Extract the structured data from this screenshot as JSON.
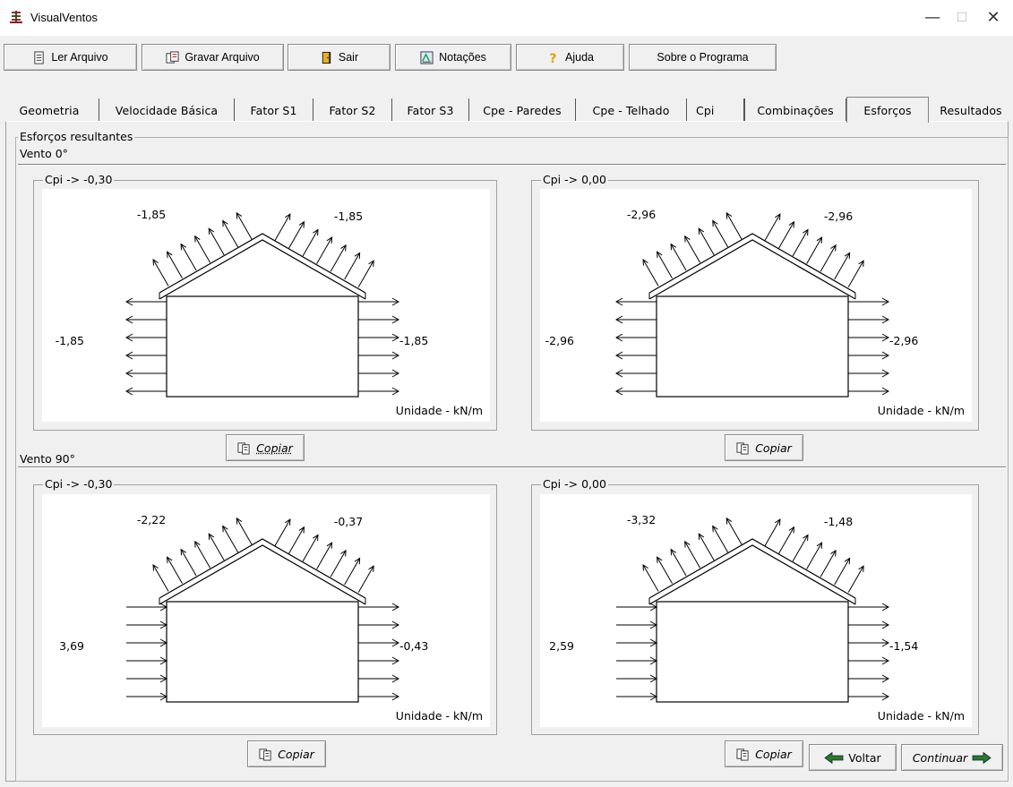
{
  "window": {
    "title": "VisualVentos",
    "minimize": "—",
    "maximize": "☐",
    "close": "✕"
  },
  "toolbar": {
    "open_label": "Ler Arquivo",
    "save_label": "Gravar Arquivo",
    "exit_label": "Sair",
    "notation_label": "Notações",
    "help_label": "Ajuda",
    "about_label": "Sobre o Programa"
  },
  "tabs": [
    {
      "label": "Geometria"
    },
    {
      "label": "Velocidade Básica"
    },
    {
      "label": "Fator S1"
    },
    {
      "label": "Fator S2"
    },
    {
      "label": "Fator S3"
    },
    {
      "label": "Cpe - Paredes"
    },
    {
      "label": "Cpe - Telhado"
    },
    {
      "label": "Cpi"
    },
    {
      "label": "Combinações"
    },
    {
      "label": "Esforços"
    },
    {
      "label": "Resultados"
    }
  ],
  "main": {
    "group_title": "Esforços resultantes",
    "unit": "Unidade - kN/m",
    "copy_label": "Copiar",
    "back_label": "Voltar",
    "next_label": "Continuar"
  },
  "sections": [
    {
      "title": "Vento 0°",
      "diagrams": [
        {
          "cpi_label": "Cpi -> -0,30",
          "roof_left": "-1,85",
          "roof_right": "-1,85",
          "wall_left": "-1,85",
          "wall_right": "-1,85",
          "left_wall_dir": "out",
          "right_wall_dir": "out"
        },
        {
          "cpi_label": "Cpi -> 0,00",
          "roof_left": "-2,96",
          "roof_right": "-2,96",
          "wall_left": "-2,96",
          "wall_right": "-2,96",
          "left_wall_dir": "out",
          "right_wall_dir": "out"
        }
      ]
    },
    {
      "title": "Vento 90°",
      "diagrams": [
        {
          "cpi_label": "Cpi -> -0,30",
          "roof_left": "-2,22",
          "roof_right": "-0,37",
          "wall_left": "3,69",
          "wall_right": "-0,43",
          "left_wall_dir": "in",
          "right_wall_dir": "out"
        },
        {
          "cpi_label": "Cpi -> 0,00",
          "roof_left": "-3,32",
          "roof_right": "-1,48",
          "wall_left": "2,59",
          "wall_right": "-1,54",
          "left_wall_dir": "in",
          "right_wall_dir": "out"
        }
      ]
    }
  ]
}
